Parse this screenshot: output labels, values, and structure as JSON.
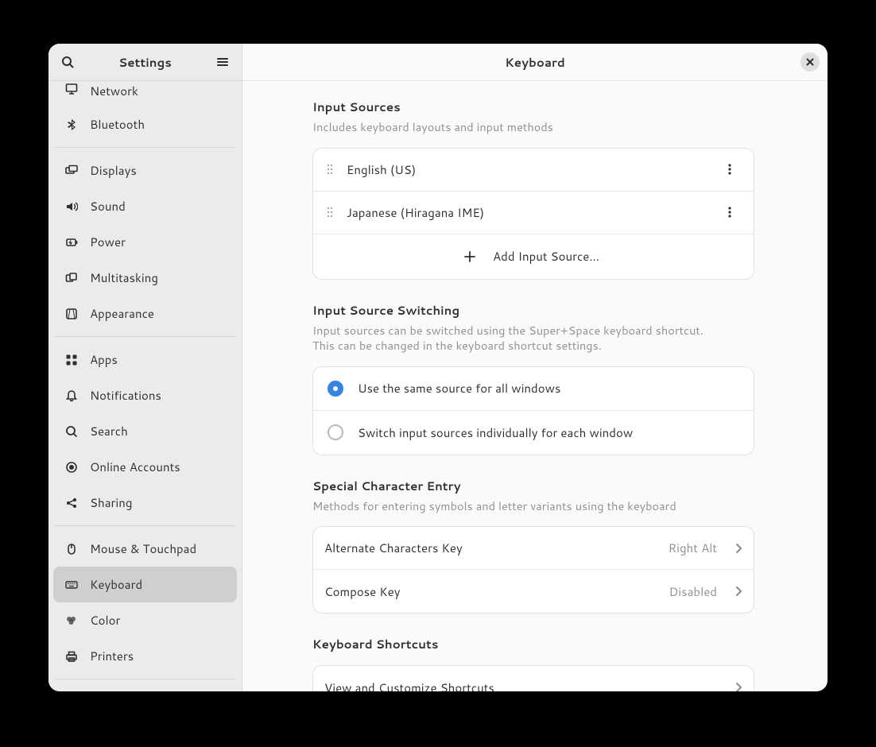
{
  "sidebar": {
    "title": "Settings",
    "items": [
      {
        "label": "Network",
        "icon": "monitor"
      },
      {
        "label": "Bluetooth",
        "icon": "bluetooth"
      },
      {
        "label": "Displays",
        "icon": "displays"
      },
      {
        "label": "Sound",
        "icon": "sound"
      },
      {
        "label": "Power",
        "icon": "power"
      },
      {
        "label": "Multitasking",
        "icon": "multitasking"
      },
      {
        "label": "Appearance",
        "icon": "appearance"
      },
      {
        "label": "Apps",
        "icon": "apps"
      },
      {
        "label": "Notifications",
        "icon": "notifications"
      },
      {
        "label": "Search",
        "icon": "search"
      },
      {
        "label": "Online Accounts",
        "icon": "online-accounts"
      },
      {
        "label": "Sharing",
        "icon": "sharing"
      },
      {
        "label": "Mouse & Touchpad",
        "icon": "mouse"
      },
      {
        "label": "Keyboard",
        "icon": "keyboard",
        "selected": true
      },
      {
        "label": "Color",
        "icon": "color"
      },
      {
        "label": "Printers",
        "icon": "printers"
      }
    ]
  },
  "main": {
    "title": "Keyboard",
    "sections": {
      "input_sources": {
        "title": "Input Sources",
        "subtitle": "Includes keyboard layouts and input methods",
        "rows": [
          {
            "label": "English (US)"
          },
          {
            "label": "Japanese (Hiragana IME)"
          }
        ],
        "add_label": "Add Input Source…"
      },
      "switching": {
        "title": "Input Source Switching",
        "subtitle_line1": "Input sources can be switched using the Super+Space keyboard shortcut.",
        "subtitle_line2": "This can be changed in the keyboard shortcut settings.",
        "options": [
          {
            "label": "Use the same source for all windows",
            "checked": true
          },
          {
            "label": "Switch input sources individually for each window",
            "checked": false
          }
        ]
      },
      "special": {
        "title": "Special Character Entry",
        "subtitle": "Methods for entering symbols and letter variants using the keyboard",
        "rows": [
          {
            "label": "Alternate Characters Key",
            "value": "Right Alt"
          },
          {
            "label": "Compose Key",
            "value": "Disabled"
          }
        ]
      },
      "shortcuts": {
        "title": "Keyboard Shortcuts",
        "row": {
          "label": "View and Customize Shortcuts"
        }
      }
    }
  }
}
